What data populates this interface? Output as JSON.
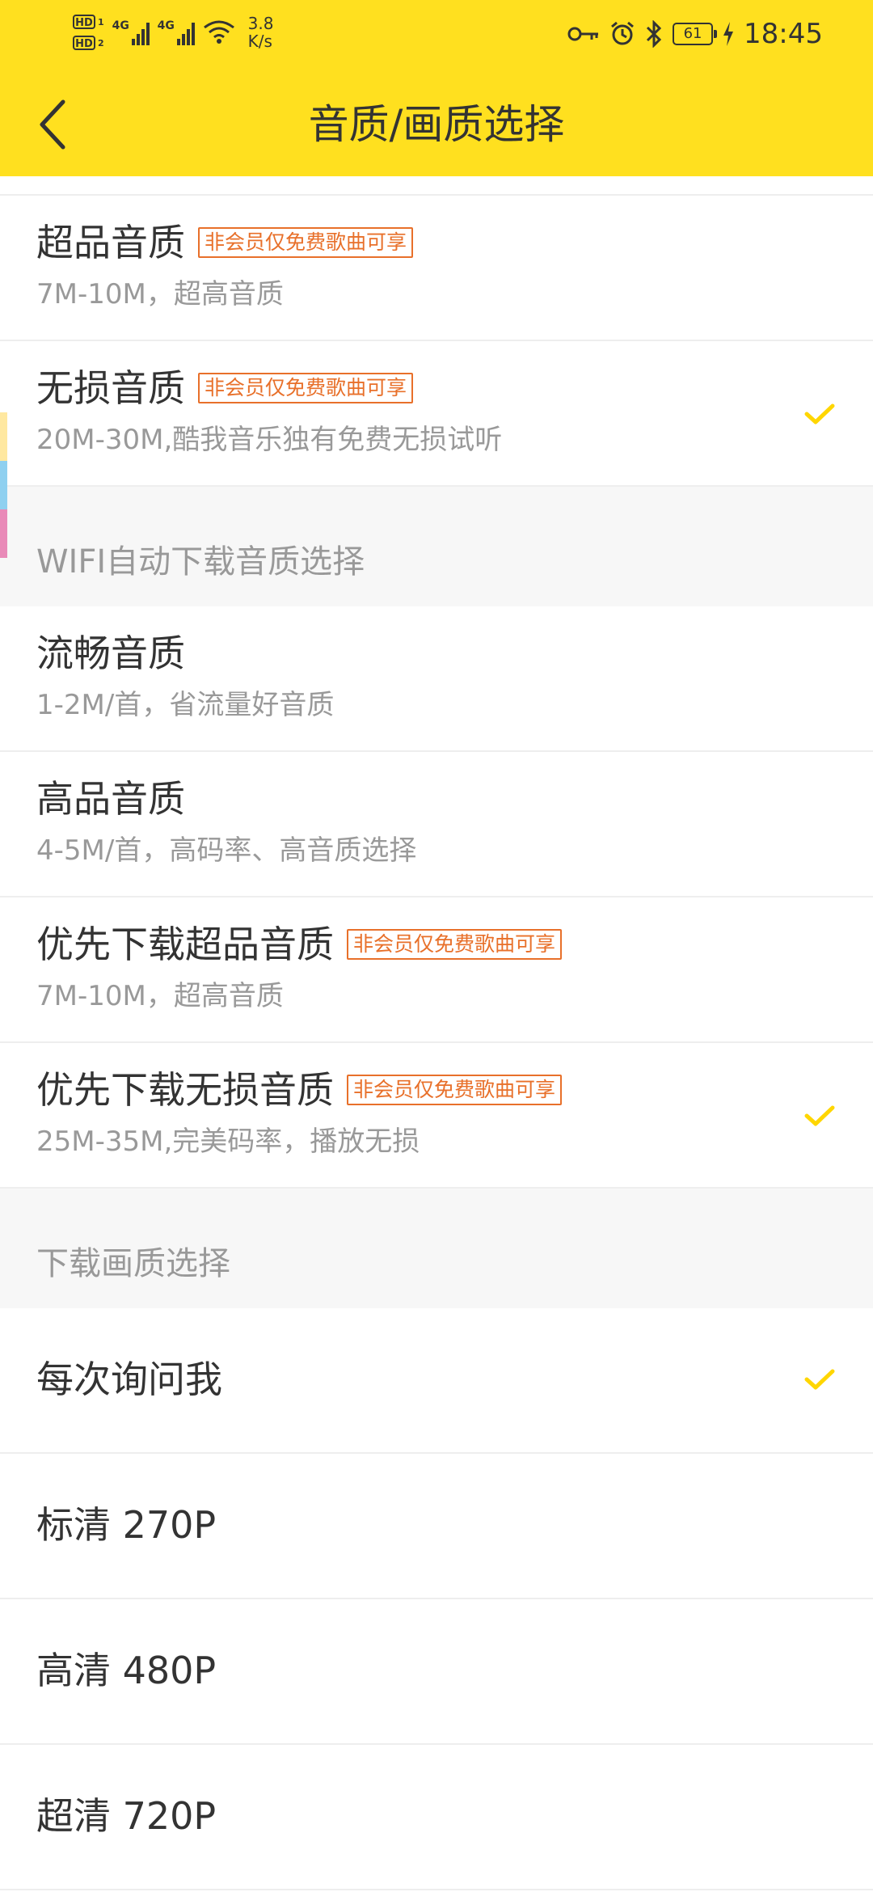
{
  "status": {
    "hd1": "HD",
    "hd1_sub": "1",
    "hd2": "HD",
    "hd2_sub": "2",
    "net1": "4G",
    "net2": "4G",
    "speed_value": "3.8",
    "speed_unit": "K/s",
    "battery": "61",
    "time": "18:45"
  },
  "header": {
    "title": "音质/画质选择",
    "back_icon": "chevron-left-icon"
  },
  "colors": {
    "header_bg": "#FFE01F",
    "check": "#FFD600",
    "badge": "#E8702A"
  },
  "play_quality": {
    "items": [
      {
        "title": "超品音质",
        "badge": "非会员仅免费歌曲可享",
        "subtitle": "7M-10M，超高音质",
        "selected": false
      },
      {
        "title": "无损音质",
        "badge": "非会员仅免费歌曲可享",
        "subtitle": "20M-30M,酷我音乐独有免费无损试听",
        "selected": true
      }
    ]
  },
  "wifi_download": {
    "section_title": "WIFI自动下载音质选择",
    "items": [
      {
        "title": "流畅音质",
        "subtitle": "1-2M/首，省流量好音质",
        "selected": false
      },
      {
        "title": "高品音质",
        "subtitle": "4-5M/首，高码率、高音质选择",
        "selected": false
      },
      {
        "title": "优先下载超品音质",
        "badge": "非会员仅免费歌曲可享",
        "subtitle": "7M-10M，超高音质",
        "selected": false
      },
      {
        "title": "优先下载无损音质",
        "badge": "非会员仅免费歌曲可享",
        "subtitle": "25M-35M,完美码率，播放无损",
        "selected": true
      }
    ]
  },
  "video_download": {
    "section_title": "下载画质选择",
    "items": [
      {
        "title": "每次询问我",
        "selected": true
      },
      {
        "title": "标清 270P",
        "selected": false
      },
      {
        "title": "高清 480P",
        "selected": false
      },
      {
        "title": "超清 720P",
        "selected": false
      }
    ]
  }
}
